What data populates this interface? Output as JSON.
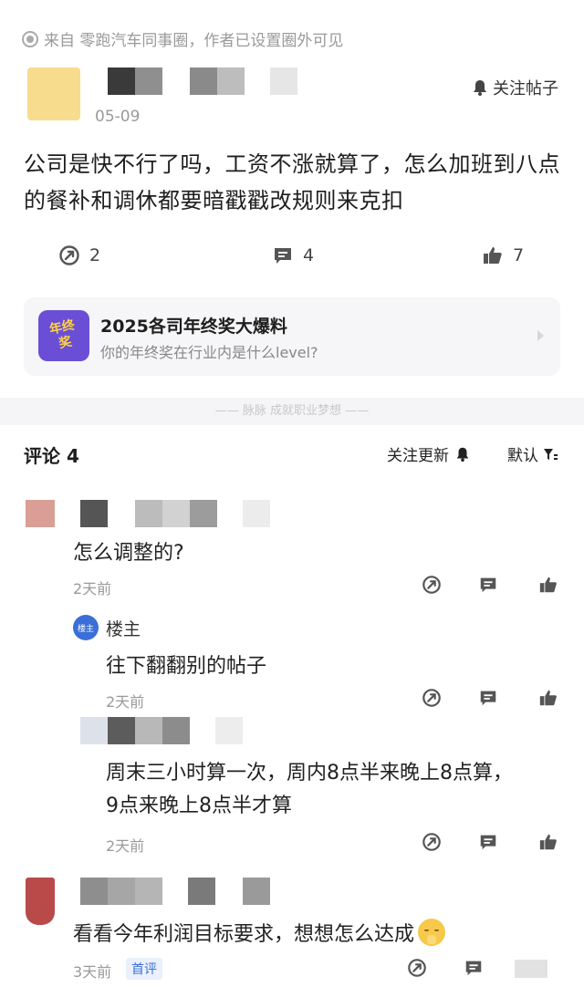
{
  "source_line": "来自 零跑汽车同事圈，作者已设置圈外可见",
  "post": {
    "date": "05-09",
    "follow_label": "关注帖子",
    "body_line1": "公司是快不行了吗，工资不涨就算了，怎么加班到八点",
    "body_line2": "的餐补和调休都要暗戳戳改规则来克扣",
    "share_count": "2",
    "comment_count": "4",
    "like_count": "7"
  },
  "promo": {
    "badge_text": "年终奖",
    "title": "2025各司年终奖大爆料",
    "subtitle": "你的年终奖在行业内是什么level?"
  },
  "divider_text": "—— 脉脉  成就职业梦想 ——",
  "comments_header": {
    "title": "评论 4",
    "follow_updates": "关注更新",
    "sort": "默认"
  },
  "comments": [
    {
      "text": "怎么调整的?",
      "time": "2天前"
    },
    {
      "author": "楼主",
      "author_badge": "楼主",
      "text": "往下翻翻别的帖子",
      "time": "2天前"
    },
    {
      "text_line1": "周末三小时算一次，周内8点半来晚上8点算，",
      "text_line2": "9点来晚上8点半才算",
      "time": "2天前"
    },
    {
      "text": "看看今年利润目标要求，想想怎么达成",
      "time": "3天前",
      "tag": "首评"
    }
  ],
  "colors": {
    "accent_blue": "#3b6fd8",
    "icon_gray": "#5a5a5a",
    "badge_purple": "#6a4fd6",
    "badge_yellow": "#ffd23f"
  }
}
